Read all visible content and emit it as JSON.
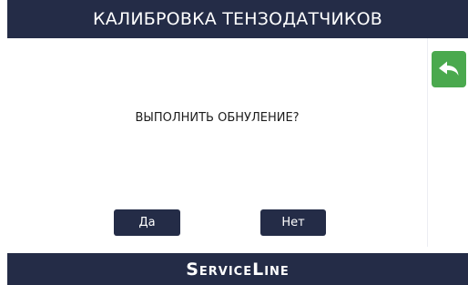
{
  "header": {
    "title": "КАЛИБРОВКА ТЕНЗОДАТЧИКОВ"
  },
  "dialog": {
    "question": "ВЫПОЛНИТЬ ОБНУЛЕНИЕ?",
    "yes_label": "Да",
    "no_label": "Нет"
  },
  "back_button": {
    "icon": "back-arrow-icon",
    "color": "#4aa94e"
  },
  "footer": {
    "brand": "ServiceLine"
  },
  "colors": {
    "bar": "#242c47",
    "background": "#ffffff",
    "accent": "#4aa94e"
  }
}
